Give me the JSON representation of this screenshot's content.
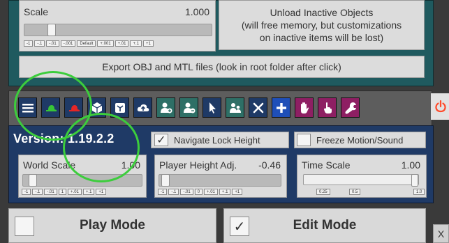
{
  "scale": {
    "label": "Scale",
    "value": "1.000",
    "slider_fraction": 0.13,
    "steps": [
      "-1",
      "-.1",
      "-.01",
      "-.001",
      "Default",
      "+.001",
      "+.01",
      "+.1",
      "+1"
    ]
  },
  "unload": {
    "label": "Unload Inactive Objects\n(will free memory, but customizations\non inactive items will be lost)"
  },
  "export": {
    "label": "Export OBJ and MTL files (look in root folder after click)"
  },
  "toolbar": {
    "icons": [
      "menu-icon",
      "hat-green-icon",
      "hat-red-icon",
      "cube-icon",
      "box-open-icon",
      "cloud-upload-icon",
      "add-person-icon",
      "remove-person-icon",
      "cursor-icon",
      "people-icon",
      "tools-icon",
      "plus-icon",
      "hand-icon",
      "pointing-hand-icon",
      "wrench-icon"
    ],
    "colors": {
      "dark": "#1f3a66",
      "green": "#2e8b3a",
      "red": "#d61f1f",
      "teal": "#2e6f66",
      "blue": "#1f4fb8",
      "purple": "#8e1f63",
      "accent_power": "#ff4a2a"
    }
  },
  "version": {
    "text": "Version: 1.19.2.2"
  },
  "navigate_lock": {
    "label": "Navigate Lock Height",
    "checked": true
  },
  "freeze": {
    "label": "Freeze Motion/Sound",
    "checked": false
  },
  "world_scale": {
    "label": "World Scale",
    "value": "1.00",
    "slider_fraction": 0.05,
    "steps": [
      "-1",
      "-.1",
      "-.01",
      "1",
      "+.01",
      "+.1",
      "+1"
    ]
  },
  "player_height": {
    "label": "Player Height Adj.",
    "value": "-0.46",
    "slider_fraction": 0.02,
    "steps": [
      "-1",
      "-.1",
      "-.01",
      "0",
      "+.01",
      "+.1",
      "+1"
    ]
  },
  "time_scale": {
    "label": "Time Scale",
    "value": "1.00",
    "slider_fraction": 1.0,
    "ticks": [
      "0.25",
      "0.5",
      "1.0"
    ]
  },
  "play_mode": {
    "label": "Play Mode",
    "checked": false
  },
  "edit_mode": {
    "label": "Edit Mode",
    "checked": true
  },
  "close": {
    "label": "X"
  }
}
